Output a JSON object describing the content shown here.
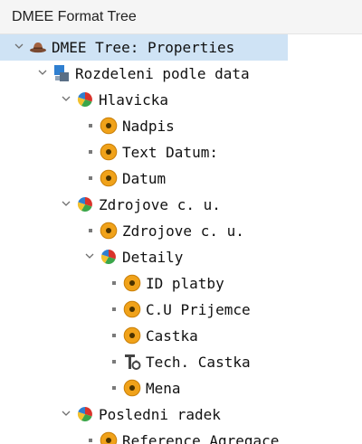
{
  "panel": {
    "title": "DMEE Format Tree"
  },
  "tree": {
    "nodes": [
      {
        "label": "DMEE Tree: Properties",
        "icon": "hat-icon",
        "level": 0,
        "expanded": true,
        "selected": true
      },
      {
        "label": "Rozdeleni podle data",
        "icon": "blocks-icon",
        "level": 1,
        "expanded": true
      },
      {
        "label": "Hlavicka",
        "icon": "segment-icon",
        "level": 2,
        "expanded": true
      },
      {
        "label": "Nadpis",
        "icon": "element-icon",
        "level": 3
      },
      {
        "label": "Text Datum:",
        "icon": "element-icon",
        "level": 3
      },
      {
        "label": "Datum",
        "icon": "element-icon",
        "level": 3
      },
      {
        "label": "Zdrojove c. u.",
        "icon": "segment-icon",
        "level": 2,
        "expanded": true
      },
      {
        "label": "Zdrojove c. u.",
        "icon": "element-icon",
        "level": 3
      },
      {
        "label": "Detaily",
        "icon": "segment-icon",
        "level": 3,
        "expanded": true
      },
      {
        "label": "ID platby",
        "icon": "element-icon",
        "level": 4
      },
      {
        "label": "C.U Prijemce",
        "icon": "element-icon",
        "level": 4
      },
      {
        "label": "Castka",
        "icon": "element-icon",
        "level": 4
      },
      {
        "label": "Tech. Castka",
        "icon": "technical-node-icon",
        "level": 4
      },
      {
        "label": "Mena",
        "icon": "element-icon",
        "level": 4
      },
      {
        "label": "Posledni radek",
        "icon": "segment-icon",
        "level": 2,
        "expanded": true
      },
      {
        "label": "Reference Agregace",
        "icon": "element-icon",
        "level": 3
      }
    ]
  },
  "colors": {
    "selection": "#cfe3f5",
    "element_orange": "#f0a21a",
    "segment_red": "#d9332b",
    "segment_green": "#3aa64a",
    "segment_blue": "#2f7fd0",
    "segment_yellow": "#f2c12e"
  }
}
